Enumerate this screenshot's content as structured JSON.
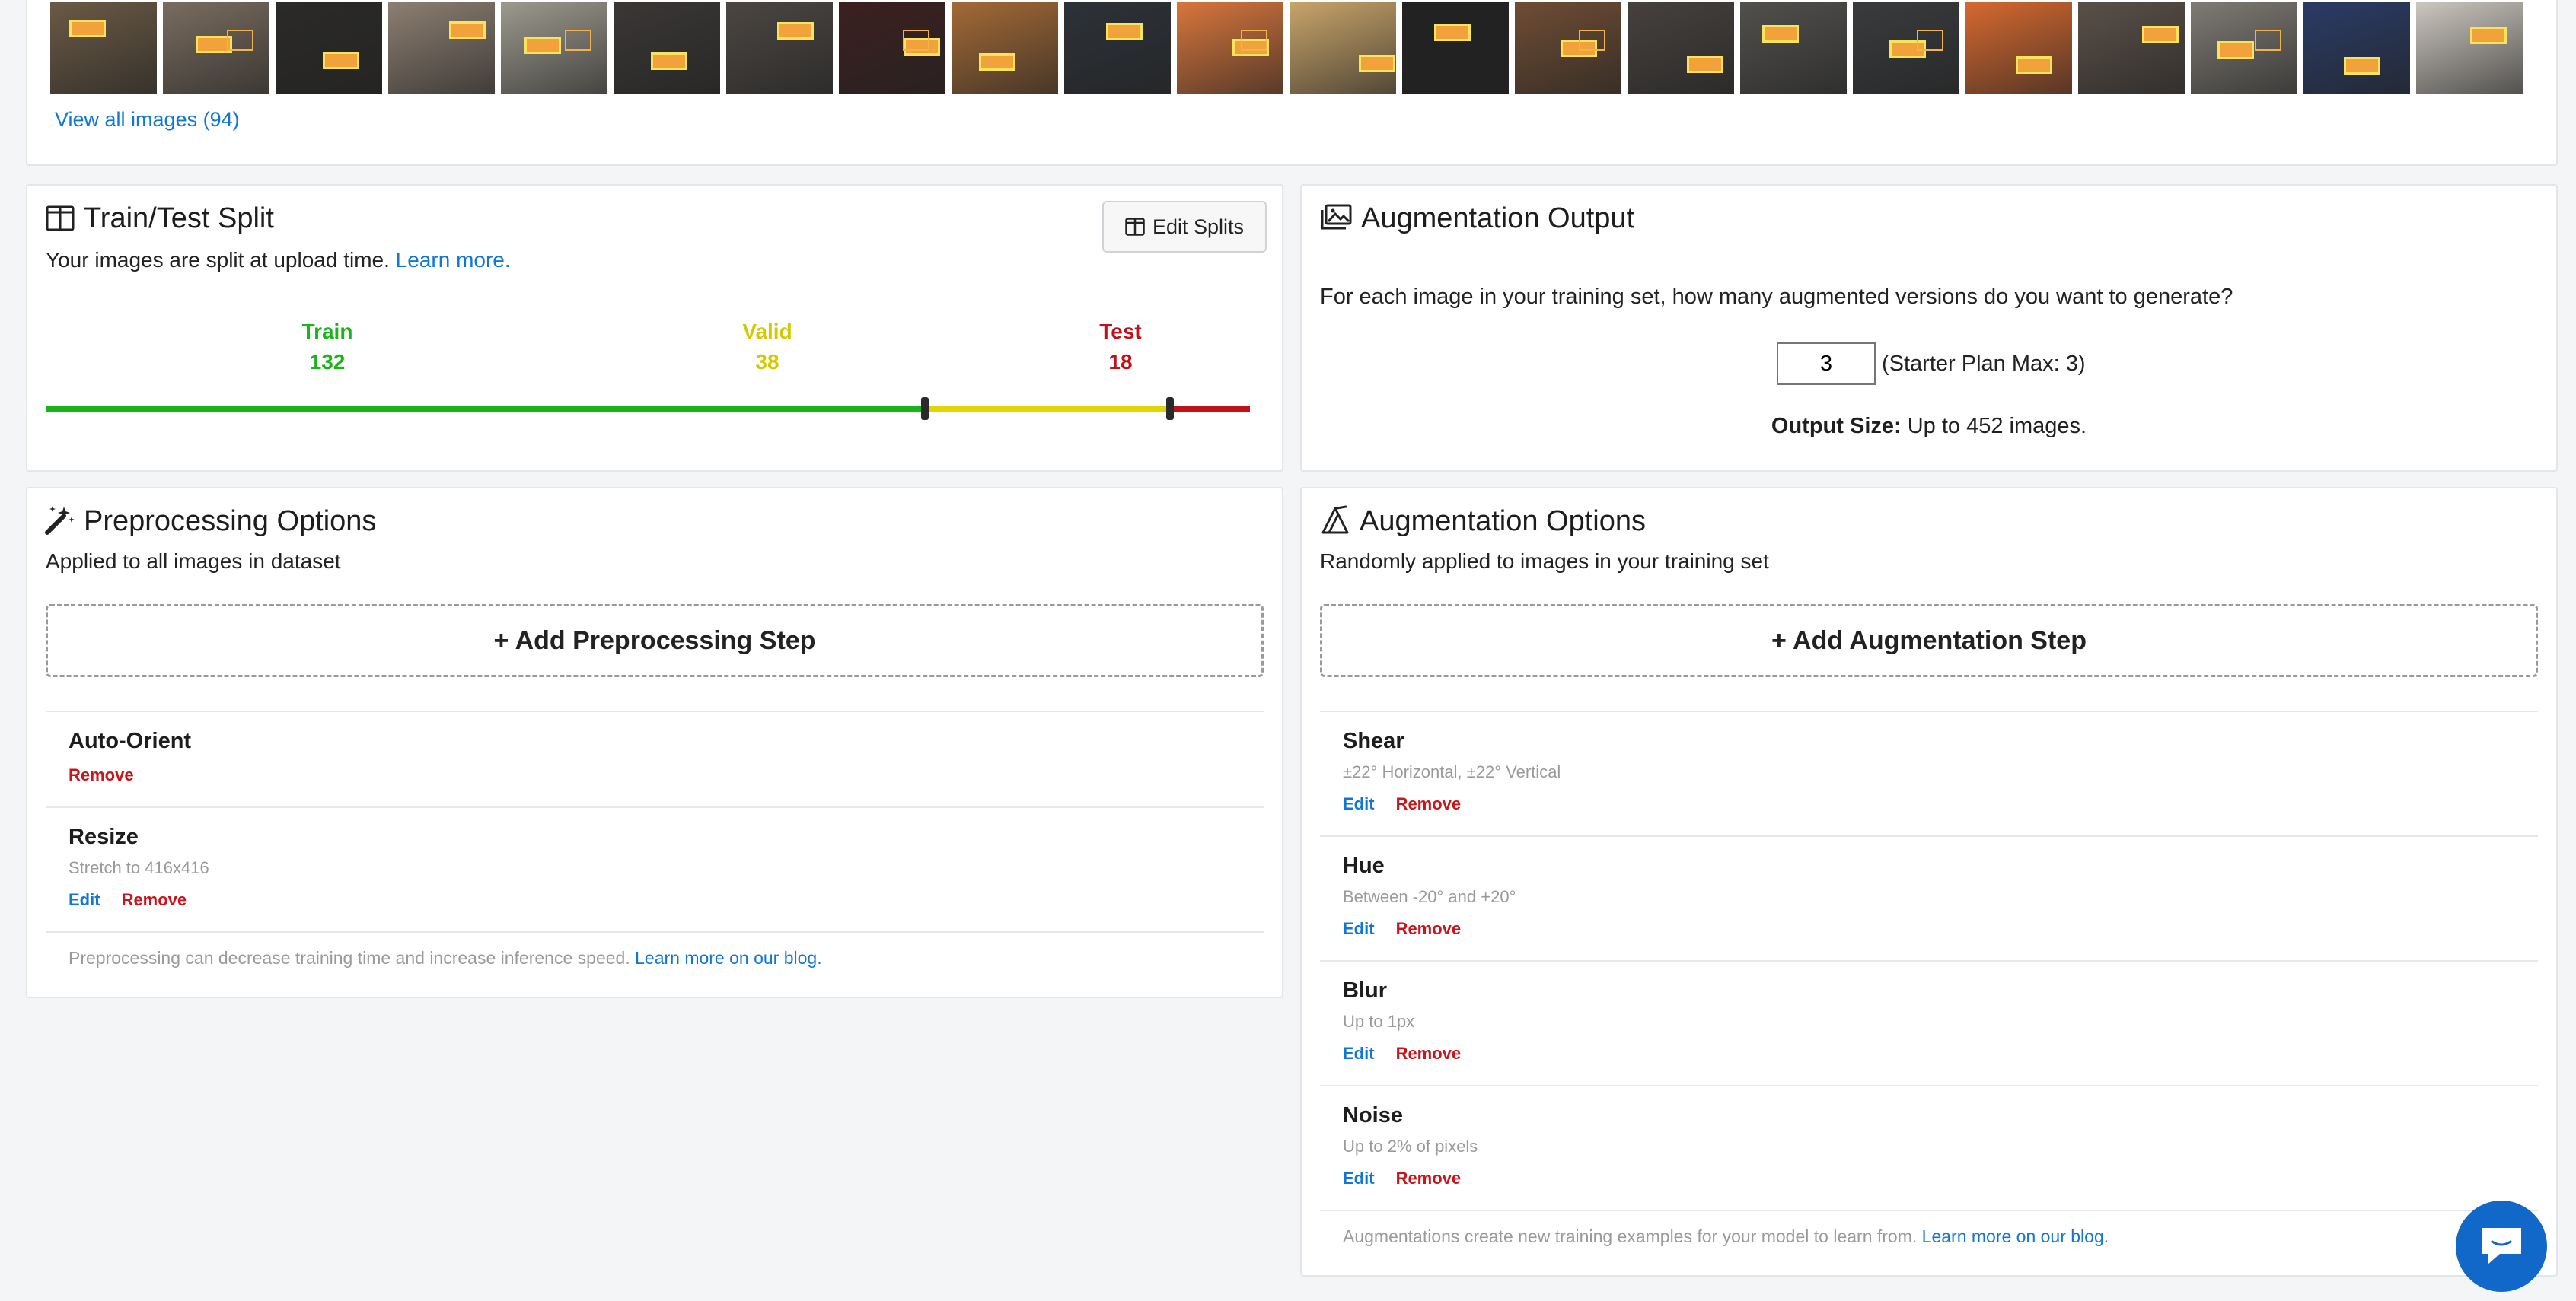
{
  "gallery": {
    "view_all": "View all images (94)",
    "thumbnails": [
      {
        "bg": "#6b5a45",
        "alt": "orange box"
      },
      {
        "bg": "#7a6d60",
        "alt": "labels on table"
      },
      {
        "bg": "#2b2a28",
        "alt": "mug and box"
      },
      {
        "bg": "#8d7f72",
        "alt": "hand with orange"
      },
      {
        "bg": "#9d9a8e",
        "alt": "labels grid"
      },
      {
        "bg": "#3a3735",
        "alt": "orange marker"
      },
      {
        "bg": "#4b4642",
        "alt": "box on table"
      },
      {
        "bg": "#3c2020",
        "alt": "red room"
      },
      {
        "bg": "#a46a36",
        "alt": "orange cabinet"
      },
      {
        "bg": "#2d3238",
        "alt": "dark desk"
      },
      {
        "bg": "#d9763c",
        "alt": "ordina sign"
      },
      {
        "bg": "#c9a56a",
        "alt": "ordina card"
      },
      {
        "bg": "#222222",
        "alt": "shield logo"
      },
      {
        "bg": "#6f4d34",
        "alt": "mug orange"
      },
      {
        "bg": "#46413e",
        "alt": "marker on desk"
      },
      {
        "bg": "#51504d",
        "alt": "orange puck"
      },
      {
        "bg": "#393b3d",
        "alt": "box corner"
      },
      {
        "bg": "#d7692f",
        "alt": "ordina banner"
      },
      {
        "bg": "#5a5048",
        "alt": "mug and marker"
      },
      {
        "bg": "#7f7b74",
        "alt": "papers"
      },
      {
        "bg": "#2a3b66",
        "alt": "license plate"
      },
      {
        "bg": "#ccc7bf",
        "alt": "monitor"
      }
    ]
  },
  "split": {
    "title": "Train/Test Split",
    "subtitle": "Your images are split at upload time.",
    "learn_more": "Learn more.",
    "edit_button": "Edit Splits",
    "train": {
      "label": "Train",
      "value": "132",
      "color": "#18b418"
    },
    "valid": {
      "label": "Valid",
      "value": "38",
      "color": "#d6c800"
    },
    "test": {
      "label": "Test",
      "value": "18",
      "color": "#c0121a"
    }
  },
  "augmentation_output": {
    "title": "Augmentation Output",
    "question": "For each image in your training set, how many augmented versions do you want to generate?",
    "count_value": "3",
    "plan_note": "(Starter Plan Max: 3)",
    "output_label": "Output Size:",
    "output_value": "Up to 452 images."
  },
  "preprocessing": {
    "title": "Preprocessing Options",
    "subtitle": "Applied to all images in dataset",
    "add_step": "+ Add Preprocessing Step",
    "steps": [
      {
        "name": "Auto-Orient",
        "desc": "",
        "edit": "",
        "remove": "Remove"
      },
      {
        "name": "Resize",
        "desc": "Stretch to 416x416",
        "edit": "Edit",
        "remove": "Remove"
      }
    ],
    "note": "Preprocessing can decrease training time and increase inference speed.",
    "note_link": "Learn more on our blog."
  },
  "augmentation": {
    "title": "Augmentation Options",
    "subtitle": "Randomly applied to images in your training set",
    "add_step": "+ Add Augmentation Step",
    "steps": [
      {
        "name": "Shear",
        "desc": "±22° Horizontal, ±22° Vertical",
        "edit": "Edit",
        "remove": "Remove"
      },
      {
        "name": "Hue",
        "desc": "Between -20° and +20°",
        "edit": "Edit",
        "remove": "Remove"
      },
      {
        "name": "Blur",
        "desc": "Up to 1px",
        "edit": "Edit",
        "remove": "Remove"
      },
      {
        "name": "Noise",
        "desc": "Up to 2% of pixels",
        "edit": "Edit",
        "remove": "Remove"
      }
    ],
    "note": "Augmentations create new training examples for your model to learn from.",
    "note_link": "Learn more on our blog."
  }
}
